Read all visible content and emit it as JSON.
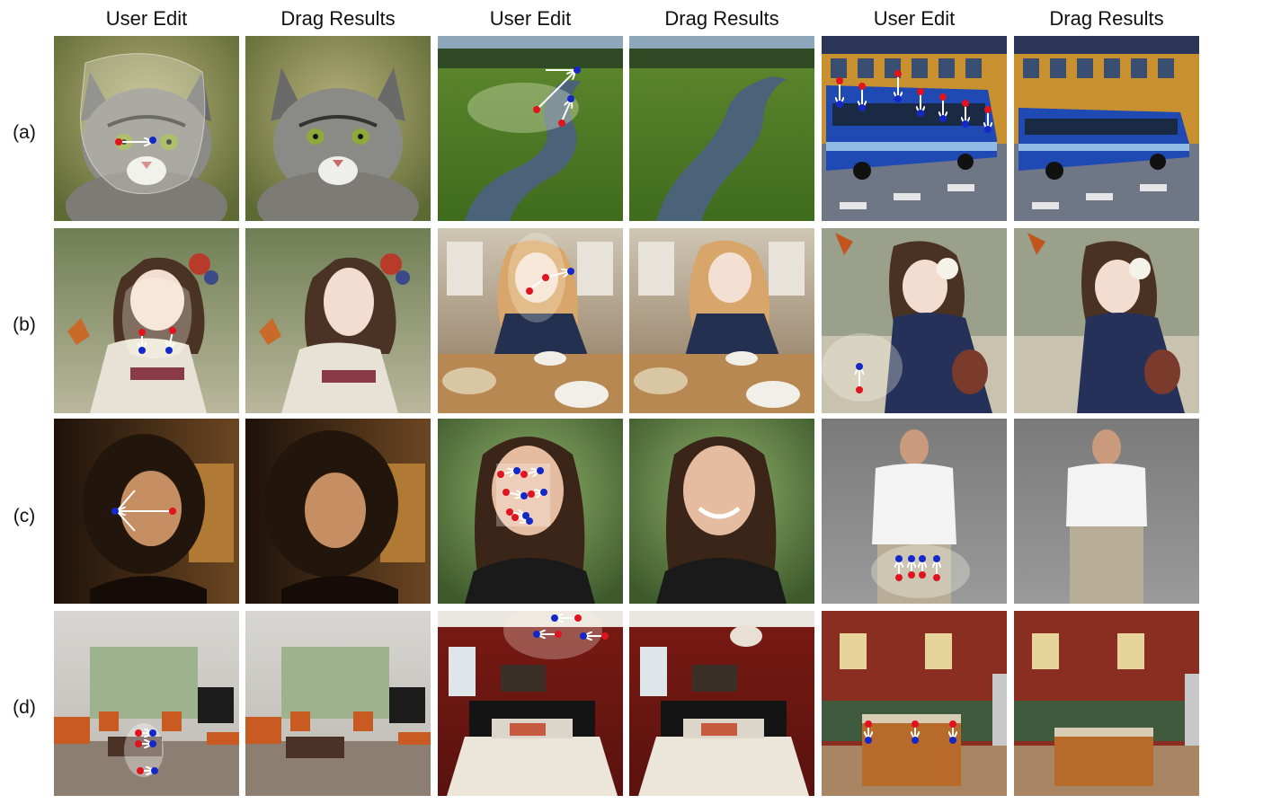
{
  "headers": [
    "User Edit",
    "Drag Results",
    "User Edit",
    "Drag Results",
    "User Edit",
    "Drag Results"
  ],
  "rows": [
    {
      "label": "(a)",
      "scenes": [
        "cat",
        "river",
        "bus"
      ]
    },
    {
      "label": "(b)",
      "scenes": [
        "kimono-girl",
        "cafe-girl",
        "yukata-girl"
      ]
    },
    {
      "label": "(c)",
      "scenes": [
        "curly-girl",
        "smiling-woman",
        "man-tshirt"
      ]
    },
    {
      "label": "(d)",
      "scenes": [
        "living-room",
        "bedroom",
        "kitchen"
      ]
    }
  ],
  "colors": {
    "handle": "#e0141e",
    "target": "#1428c8",
    "arrow": "#ffffff",
    "mask": "rgba(255,255,240,0.35)"
  }
}
